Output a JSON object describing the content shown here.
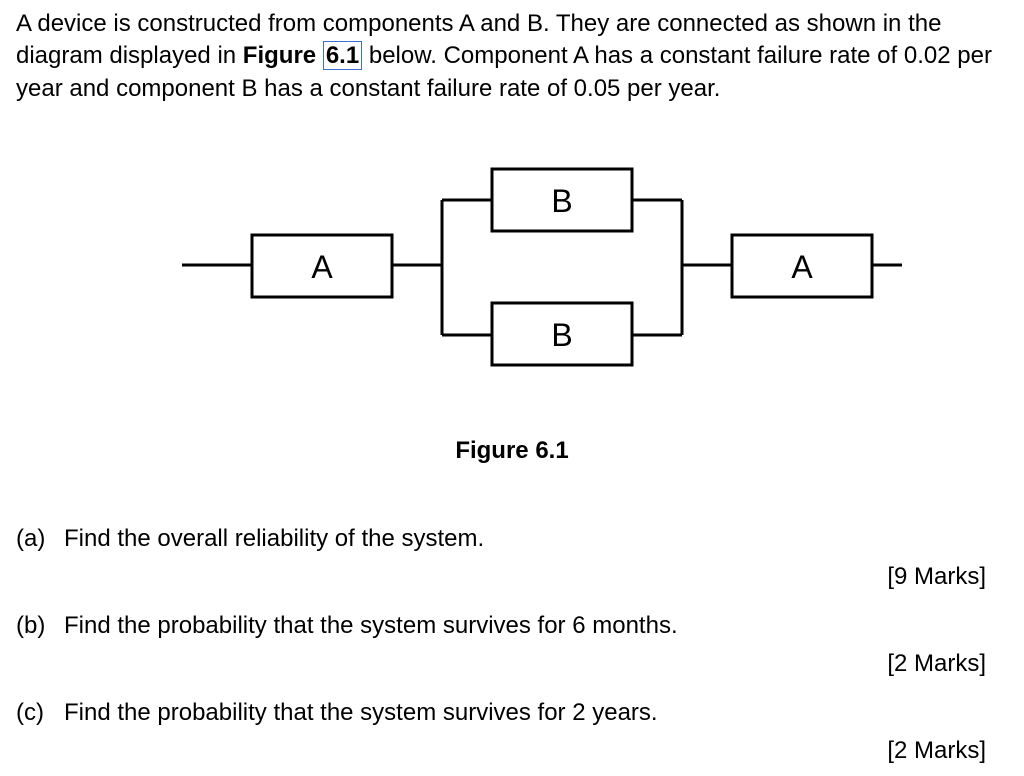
{
  "intro": {
    "sentence1": "A device is constructed from components A and B. They are connected as shown in the diagram displayed in ",
    "figure_bold": "Figure ",
    "figure_ref": "6.1",
    "sentence1_cont": " below. Component A has a constant failure rate of 0.02 per year and component B has a constant failure rate of 0.05 per year."
  },
  "diagram": {
    "blocks": {
      "left": "A",
      "top": "B",
      "bottom": "B",
      "right": "A"
    },
    "caption": "Figure 6.1"
  },
  "questions": [
    {
      "label": "(a)",
      "text": "Find the overall reliability of the system.",
      "marks": "[9 Marks]"
    },
    {
      "label": "(b)",
      "text": "Find the probability that the system survives for 6 months.",
      "marks": "[2 Marks]"
    },
    {
      "label": "(c)",
      "text": "Find the probability that the system survives for 2 years.",
      "marks": "[2 Marks]"
    }
  ]
}
